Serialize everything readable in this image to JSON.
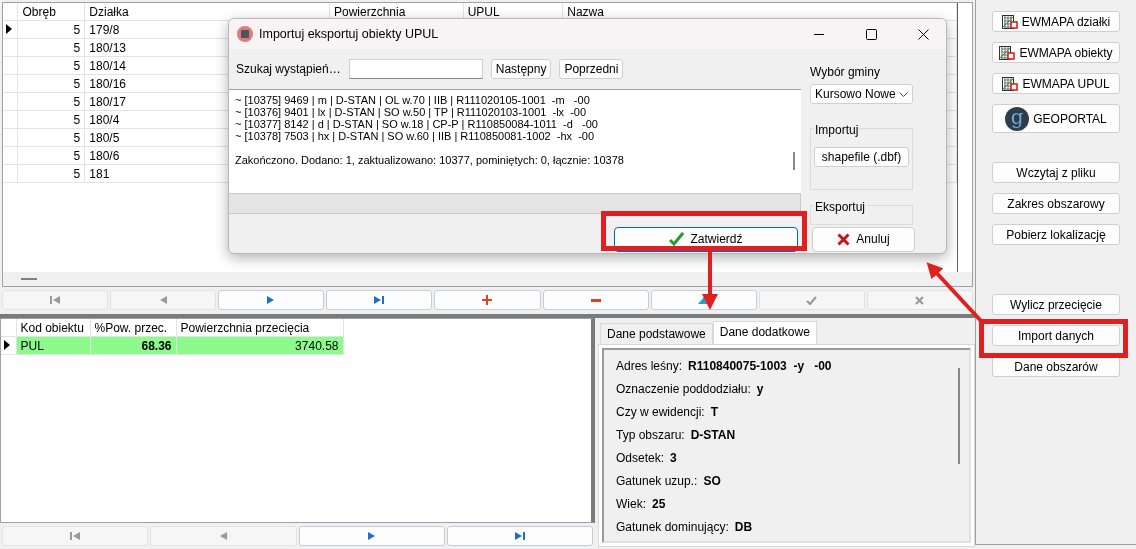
{
  "grid": {
    "columns": [
      "Obręb",
      "Działka",
      "Powierzchnia",
      "UPUL",
      "Nazwa"
    ],
    "rows": [
      {
        "cells": [
          "5",
          "179/8"
        ],
        "current": true
      },
      {
        "cells": [
          "5",
          "180/13"
        ],
        "current": false
      },
      {
        "cells": [
          "5",
          "180/14"
        ],
        "current": false
      },
      {
        "cells": [
          "5",
          "180/16"
        ],
        "current": false
      },
      {
        "cells": [
          "5",
          "180/17"
        ],
        "current": false
      },
      {
        "cells": [
          "5",
          "180/4"
        ],
        "current": false
      },
      {
        "cells": [
          "5",
          "180/5"
        ],
        "current": false
      },
      {
        "cells": [
          "5",
          "180/6"
        ],
        "current": false
      },
      {
        "cells": [
          "5",
          "181"
        ],
        "current": false
      }
    ]
  },
  "grid_nav": [
    {
      "kind": "first",
      "disabled": true
    },
    {
      "kind": "prior",
      "disabled": true
    },
    {
      "kind": "next",
      "disabled": false
    },
    {
      "kind": "last",
      "disabled": false
    },
    {
      "kind": "insert",
      "disabled": false
    },
    {
      "kind": "delete",
      "disabled": false
    },
    {
      "kind": "edit",
      "disabled": false
    },
    {
      "kind": "post",
      "disabled": true
    },
    {
      "kind": "cancel",
      "disabled": true
    }
  ],
  "intersections": {
    "columns": [
      "Kod obiektu",
      "%Pow. przec.",
      "Powierzchnia przecięcia"
    ],
    "rows": [
      {
        "cells": [
          "PUL",
          "68.36",
          "3740.58"
        ],
        "current": true,
        "highlighted": true
      }
    ]
  },
  "intersections_nav": [
    {
      "kind": "first",
      "disabled": true
    },
    {
      "kind": "prior",
      "disabled": true
    },
    {
      "kind": "next",
      "disabled": false
    },
    {
      "kind": "last",
      "disabled": false
    }
  ],
  "details": {
    "tabs": [
      {
        "label": "Dane podstawowe",
        "selected": false
      },
      {
        "label": "Dane dodatkowe",
        "selected": true
      }
    ],
    "fields": [
      {
        "label": "Adres leśny:",
        "value": "R110840075-1003  -y   -00"
      },
      {
        "label": "Oznaczenie poddodziału:",
        "value": "y"
      },
      {
        "label": "Czy w ewidencji:",
        "value": "T"
      },
      {
        "label": "Typ obszaru:",
        "value": "D-STAN"
      },
      {
        "label": "Odsetek:",
        "value": "3"
      },
      {
        "label": "Gatunek uzup.:",
        "value": "SO"
      },
      {
        "label": "Wiek:",
        "value": "25"
      },
      {
        "label": "Gatunek dominujący:",
        "value": "DB"
      }
    ]
  },
  "side_groups": [
    [
      {
        "kind": "ewmapa",
        "label": "EWMAPA działki"
      },
      {
        "kind": "ewmapa",
        "label": "EWMAPA obiekty"
      },
      {
        "kind": "ewmapa",
        "label": "EWMAPA UPUL"
      },
      {
        "kind": "geoportal",
        "label": "GEOPORTAL",
        "logo": "g"
      }
    ],
    [
      {
        "kind": "plain",
        "label": "Wczytaj z pliku"
      },
      {
        "kind": "plain",
        "label": "Zakres obszarowy"
      },
      {
        "kind": "plain",
        "label": "Pobierz lokalizację"
      }
    ],
    [
      {
        "kind": "plain",
        "label": "Wylicz przecięcie"
      },
      {
        "kind": "plain",
        "label": "Import danych"
      },
      {
        "kind": "plain",
        "label": "Dane obszarów"
      }
    ]
  ],
  "dialog": {
    "title": "Importuj eksportuj obiekty UPUL",
    "search": {
      "label": "Szukaj wystąpień…",
      "buttons": [
        "Następny",
        "Poprzedni"
      ]
    },
    "progress": {
      "level": 0
    },
    "log_lines": [
      "~ [10375] 9469 | m | D-STAN | OL w.70 | IIB | R111020105-1001  -m   -00",
      "~ [10376] 9401 | lx | D-STAN | SO w.50 | TP | R111020103-1001  -lx  -00",
      "~ [10377] 8142 | d | D-STAN | SO w.18 | CP-P | R110850084-1011  -d   -00",
      "~ [10378] 7503 | hx | D-STAN | SO w.60 | IIB | R110850081-1002  -hx  -00"
    ],
    "summary": "Zakończono. Dodano: 1, zaktualizowano: 10377, pominiętych: 0, łącznie: 10378",
    "municipality": {
      "label": "Wybór gminy",
      "value": "Kursowo Nowe"
    },
    "import_group": {
      "title": "Importuj",
      "button": "shapefile (.dbf)"
    },
    "export_group": {
      "title": "Eksportuj"
    },
    "buttons": [
      {
        "kind": "ok",
        "label": "Zatwierdź"
      },
      {
        "kind": "cancel",
        "label": "Anuluj"
      }
    ]
  }
}
